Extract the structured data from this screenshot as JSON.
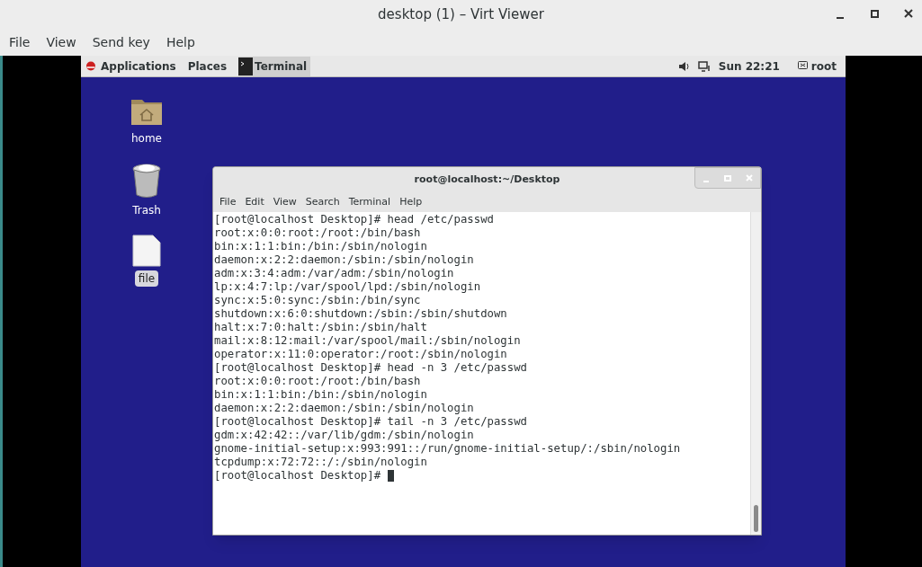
{
  "window": {
    "title": "desktop (1) – Virt Viewer"
  },
  "menu": [
    "File",
    "View",
    "Send key",
    "Help"
  ],
  "guest_panel": {
    "applications": "Applications",
    "places": "Places",
    "task": "Terminal",
    "clock": "Sun 22:21",
    "user": "root"
  },
  "desktop_icons": [
    {
      "label": "home",
      "kind": "folder",
      "selected": false
    },
    {
      "label": "Trash",
      "kind": "trash",
      "selected": false
    },
    {
      "label": "file",
      "kind": "file",
      "selected": true
    }
  ],
  "terminal": {
    "title": "root@localhost:~/Desktop",
    "menu": [
      "File",
      "Edit",
      "View",
      "Search",
      "Terminal",
      "Help"
    ],
    "lines": [
      "[root@localhost Desktop]# head /etc/passwd",
      "root:x:0:0:root:/root:/bin/bash",
      "bin:x:1:1:bin:/bin:/sbin/nologin",
      "daemon:x:2:2:daemon:/sbin:/sbin/nologin",
      "adm:x:3:4:adm:/var/adm:/sbin/nologin",
      "lp:x:4:7:lp:/var/spool/lpd:/sbin/nologin",
      "sync:x:5:0:sync:/sbin:/bin/sync",
      "shutdown:x:6:0:shutdown:/sbin:/sbin/shutdown",
      "halt:x:7:0:halt:/sbin:/sbin/halt",
      "mail:x:8:12:mail:/var/spool/mail:/sbin/nologin",
      "operator:x:11:0:operator:/root:/sbin/nologin",
      "[root@localhost Desktop]# head -n 3 /etc/passwd",
      "root:x:0:0:root:/root:/bin/bash",
      "bin:x:1:1:bin:/bin:/sbin/nologin",
      "daemon:x:2:2:daemon:/sbin:/sbin/nologin",
      "[root@localhost Desktop]# tail -n 3 /etc/passwd",
      "gdm:x:42:42::/var/lib/gdm:/sbin/nologin",
      "gnome-initial-setup:x:993:991::/run/gnome-initial-setup/:/sbin/nologin",
      "tcpdump:x:72:72::/:/sbin/nologin"
    ],
    "prompt": "[root@localhost Desktop]#"
  }
}
